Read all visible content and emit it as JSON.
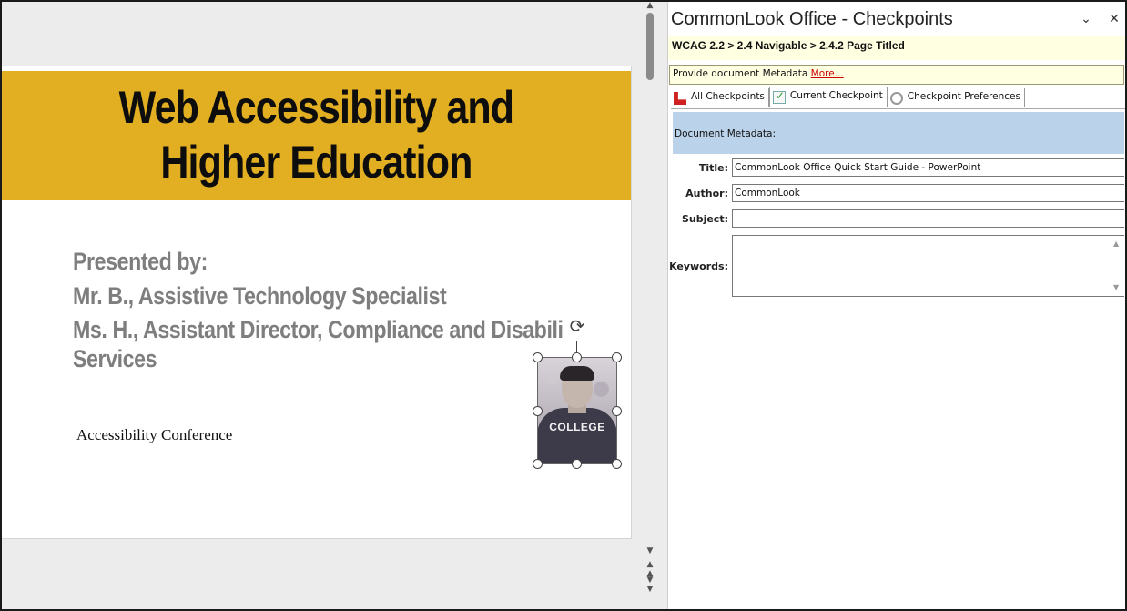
{
  "slide": {
    "title_line1": "Web Accessibility and",
    "title_line2": "Higher Education",
    "presented_by": "Presented by:",
    "presenter1": "Mr. B., Assistive Technology Specialist",
    "presenter2_line1": "Ms. H., Assistant Director, Compliance and Disabili",
    "presenter2_line2": "Services",
    "conference": "Accessibility Conference",
    "photo_caption": "COLLEGE"
  },
  "colors": {
    "title_band": "#e2ae22",
    "subtitle_text": "#7e7e7e",
    "section_header": "#bad2ea",
    "info_bar": "#ffffe1",
    "link": "#cc0000"
  },
  "pane": {
    "title": "CommonLook Office - Checkpoints",
    "collapse_icon": "chevron-down-icon",
    "close_icon": "close-icon",
    "breadcrumb": "WCAG 2.2 > 2.4 Navigable > 2.4.2 Page Titled",
    "info_text": "Provide document Metadata",
    "info_link": "More...",
    "tabs": [
      {
        "label": "All Checkpoints",
        "icon": "all-checkpoints-icon"
      },
      {
        "label": "Current Checkpoint",
        "icon": "current-checkpoint-icon"
      },
      {
        "label": "Checkpoint Preferences",
        "icon": "preferences-icon"
      }
    ],
    "section": "Document Metadata:",
    "fields": {
      "title_label": "Title:",
      "title_value": "CommonLook Office Quick Start Guide - PowerPoint",
      "author_label": "Author:",
      "author_value": "CommonLook",
      "subject_label": "Subject:",
      "subject_value": "",
      "keywords_label": "Keywords:",
      "keywords_value": ""
    }
  }
}
